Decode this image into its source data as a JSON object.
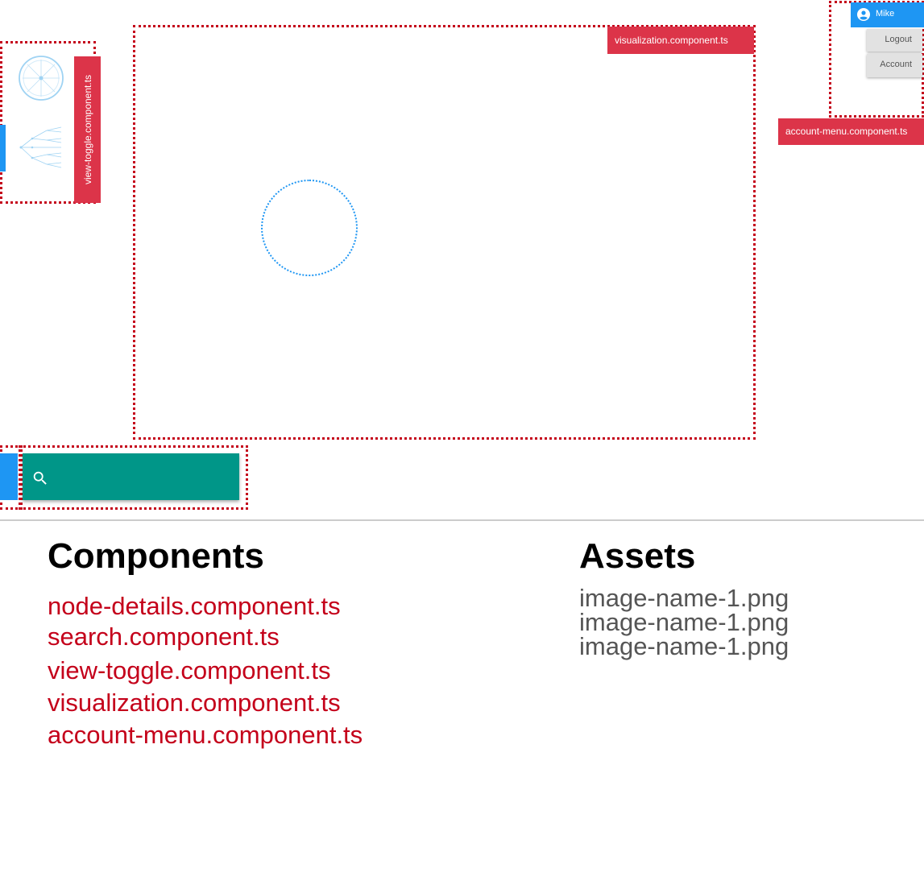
{
  "tags": {
    "view_toggle": "view-toggle.component.ts",
    "visualization": "visualization.component.ts",
    "account_menu": "account-menu.component.ts"
  },
  "account_menu": {
    "user_name": "Mike",
    "logout_label": "Logout",
    "account_label": "Account"
  },
  "legend": {
    "components_title": "Components",
    "assets_title": "Assets",
    "components": [
      "node-details.component.ts",
      "search.component.ts",
      "view-toggle.component.ts",
      "visualization.component.ts",
      "account-menu.component.ts"
    ],
    "assets": [
      "image-name-1.png",
      "image-name-1.png",
      "image-name-1.png"
    ]
  },
  "icons": {
    "view_toggle": [
      "radial-tree-icon",
      "horizontal-tree-icon"
    ],
    "search": "search-icon",
    "user": "account-circle-icon"
  },
  "colors": {
    "annotation_red": "#dc3449",
    "outline_red": "#c4001a",
    "primary_blue": "#1e96f3",
    "search_teal": "#009688"
  }
}
